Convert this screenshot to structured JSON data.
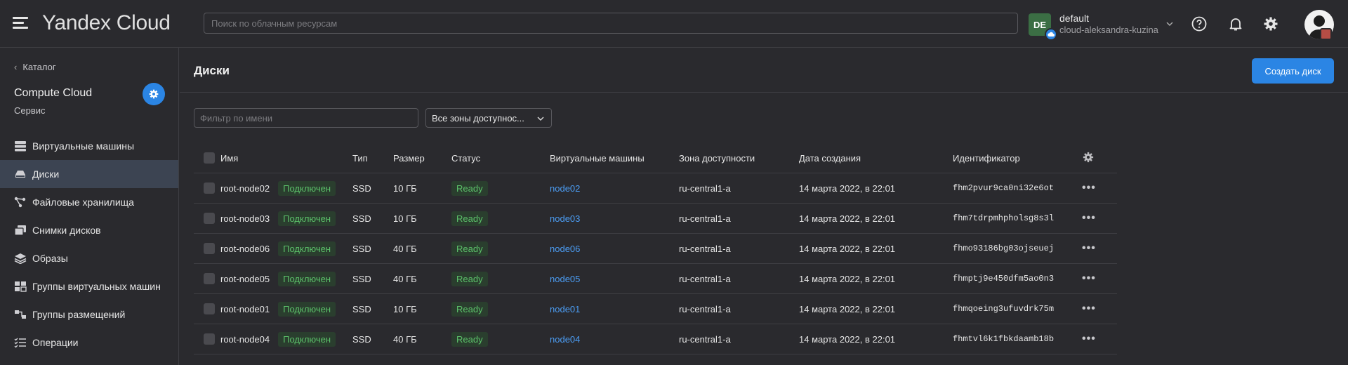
{
  "app": {
    "logo": "Yandex Cloud"
  },
  "search": {
    "placeholder": "Поиск по облачным ресурсам"
  },
  "account": {
    "badge": "DE",
    "name": "default",
    "cloud": "cloud-aleksandra-kuzina"
  },
  "sidebar": {
    "back_label": "Каталог",
    "service_title": "Compute Cloud",
    "service_sub": "Сервис",
    "items": [
      {
        "label": "Виртуальные машины",
        "icon": "servers-icon"
      },
      {
        "label": "Диски",
        "icon": "disk-icon",
        "active": true
      },
      {
        "label": "Файловые хранилища",
        "icon": "file-storage-icon"
      },
      {
        "label": "Снимки дисков",
        "icon": "snapshots-icon"
      },
      {
        "label": "Образы",
        "icon": "layers-icon"
      },
      {
        "label": "Группы виртуальных машин",
        "icon": "vm-groups-icon"
      },
      {
        "label": "Группы размещений",
        "icon": "placement-groups-icon"
      },
      {
        "label": "Операции",
        "icon": "operations-icon"
      }
    ]
  },
  "page": {
    "title": "Диски",
    "create_label": "Создать диск",
    "filter_placeholder": "Фильтр по имени",
    "zone_select": "Все зоны доступнос..."
  },
  "table": {
    "columns": {
      "name": "Имя",
      "type": "Тип",
      "size": "Размер",
      "status": "Статус",
      "vms": "Виртуальные машины",
      "zone": "Зона доступности",
      "created": "Дата создания",
      "id": "Идентификатор"
    },
    "rows": [
      {
        "name": "root-node02",
        "attached": "Подключен",
        "type": "SSD",
        "size": "10 ГБ",
        "status": "Ready",
        "vm": "node02",
        "zone": "ru-central1-a",
        "created": "14 марта 2022, в 22:01",
        "id": "fhm2pvur9ca0ni32e6ot"
      },
      {
        "name": "root-node03",
        "attached": "Подключен",
        "type": "SSD",
        "size": "10 ГБ",
        "status": "Ready",
        "vm": "node03",
        "zone": "ru-central1-a",
        "created": "14 марта 2022, в 22:01",
        "id": "fhm7tdrpmhpholsg8s3l"
      },
      {
        "name": "root-node06",
        "attached": "Подключен",
        "type": "SSD",
        "size": "40 ГБ",
        "status": "Ready",
        "vm": "node06",
        "zone": "ru-central1-a",
        "created": "14 марта 2022, в 22:01",
        "id": "fhmo93186bg03ojseuej"
      },
      {
        "name": "root-node05",
        "attached": "Подключен",
        "type": "SSD",
        "size": "40 ГБ",
        "status": "Ready",
        "vm": "node05",
        "zone": "ru-central1-a",
        "created": "14 марта 2022, в 22:01",
        "id": "fhmptj9e450dfm5ao0n3"
      },
      {
        "name": "root-node01",
        "attached": "Подключен",
        "type": "SSD",
        "size": "10 ГБ",
        "status": "Ready",
        "vm": "node01",
        "zone": "ru-central1-a",
        "created": "14 марта 2022, в 22:01",
        "id": "fhmqoeing3ufuvdrk75m"
      },
      {
        "name": "root-node04",
        "attached": "Подключен",
        "type": "SSD",
        "size": "40 ГБ",
        "status": "Ready",
        "vm": "node04",
        "zone": "ru-central1-a",
        "created": "14 марта 2022, в 22:01",
        "id": "fhmtvl6k1fbkdaamb18b"
      }
    ]
  },
  "colors": {
    "accent": "#2b85e4",
    "background": "#2a2a2e",
    "active_nav": "#3c4452",
    "ok_green": "#5cc26a",
    "link": "#4c9ef5"
  }
}
